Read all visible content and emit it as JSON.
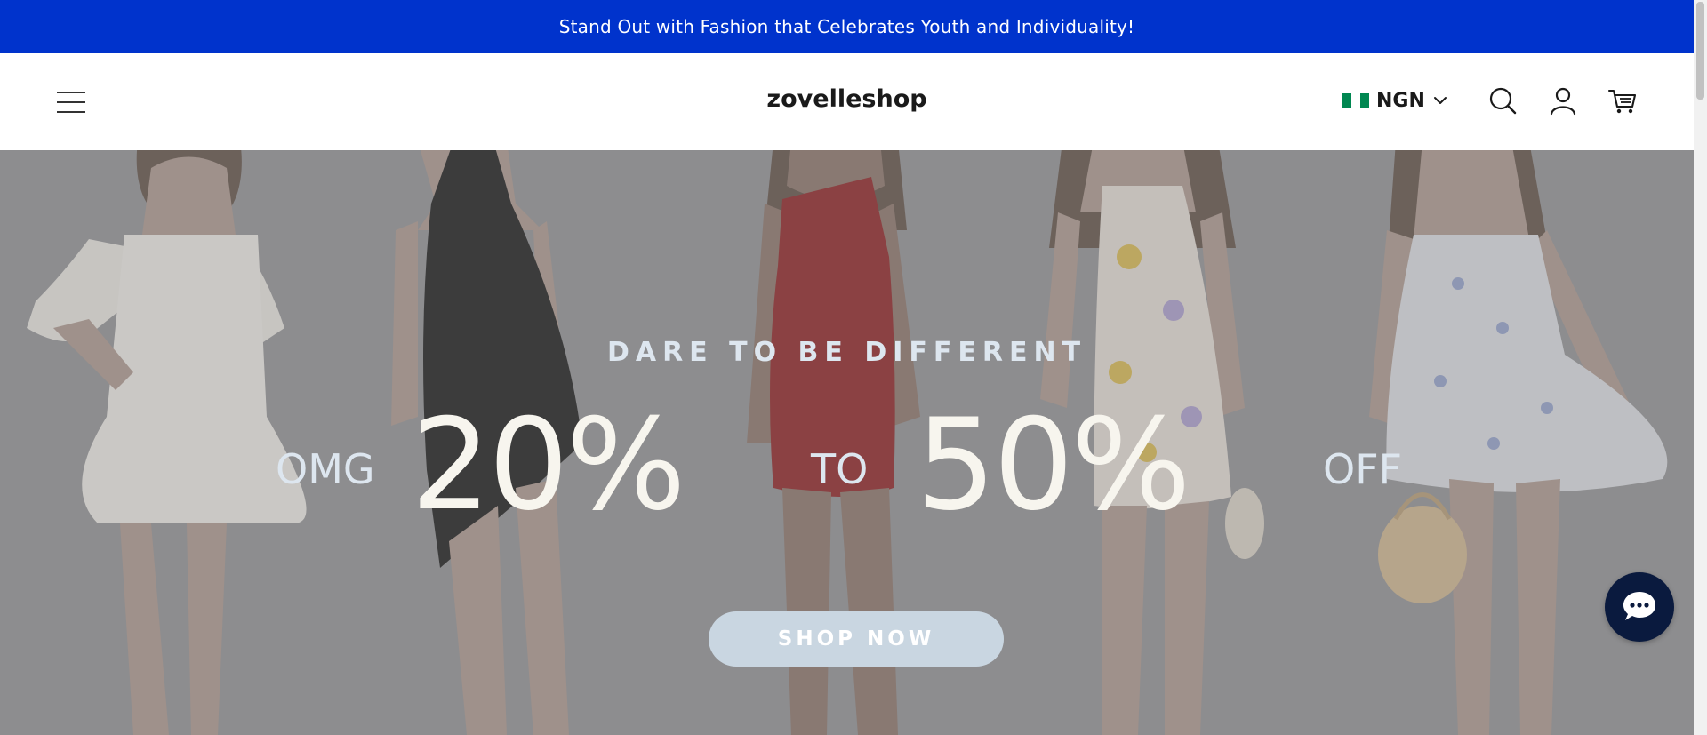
{
  "announcement": {
    "text": "Stand Out with Fashion that Celebrates Youth and Individuality!",
    "color": "#0033cc"
  },
  "header": {
    "brand": "zovelleshop",
    "currency": {
      "code": "NGN",
      "flag_colors": [
        "#008751",
        "#ffffff",
        "#008751"
      ]
    },
    "icons": [
      "menu-icon",
      "search-icon",
      "account-icon",
      "cart-icon",
      "chevron-down-icon"
    ]
  },
  "hero": {
    "tagline": "DARE TO BE DIFFERENT",
    "promo": {
      "prefix": "OMG",
      "first": "20%",
      "middle": "TO",
      "second": "50%",
      "suffix": "OFF"
    },
    "cta": "SHOP NOW",
    "dresses": [
      {
        "name": "white lace off-shoulder dress",
        "color": "#ece9e4"
      },
      {
        "name": "black halter dress",
        "color": "#121212"
      },
      {
        "name": "red one-shoulder dress",
        "color": "#8b1a1c"
      },
      {
        "name": "floral halter dress",
        "color": "#e4ddd9"
      },
      {
        "name": "blue floral strapless dress",
        "color": "#d9dbe0"
      }
    ]
  },
  "chat": {
    "icon": "chat-icon",
    "color": "#0a1a3e"
  }
}
